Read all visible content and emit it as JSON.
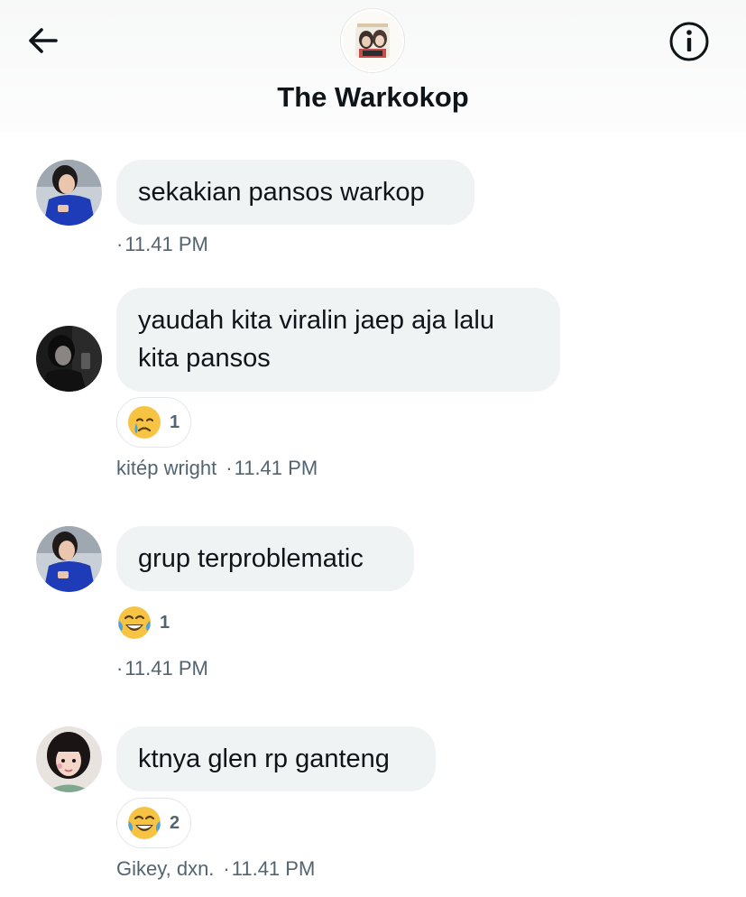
{
  "header": {
    "title": "The Warkokop",
    "back_icon": "arrow-left-icon",
    "info_icon": "info-circle-icon"
  },
  "messages": [
    {
      "text": "sekakian pansos warkop",
      "avatar": "blue-shirt-user-avatar",
      "reaction": null,
      "sender": "",
      "time": "11.41 PM"
    },
    {
      "text": "yaudah kita viralin jaep aja lalu kita pansos",
      "avatar": "dark-photo-user-avatar",
      "reaction": {
        "emoji": "crying-face-emoji",
        "count": "1"
      },
      "sender": "kitép wright",
      "time": "11.41 PM"
    },
    {
      "text": "grup terproblematic",
      "avatar": "blue-shirt-user-avatar",
      "reaction": {
        "emoji": "tears-of-joy-emoji",
        "count": "1"
      },
      "sender": "",
      "time": "11.41 PM"
    },
    {
      "text": "ktnya glen rp ganteng",
      "avatar": "pink-hair-user-avatar",
      "reaction": {
        "emoji": "tears-of-joy-emoji",
        "count": "2"
      },
      "sender": "Gikey, dxn.",
      "time": "11.41 PM"
    }
  ],
  "colors": {
    "bubble": "#eff3f4",
    "text": "#0f1419",
    "secondary": "#536471"
  }
}
